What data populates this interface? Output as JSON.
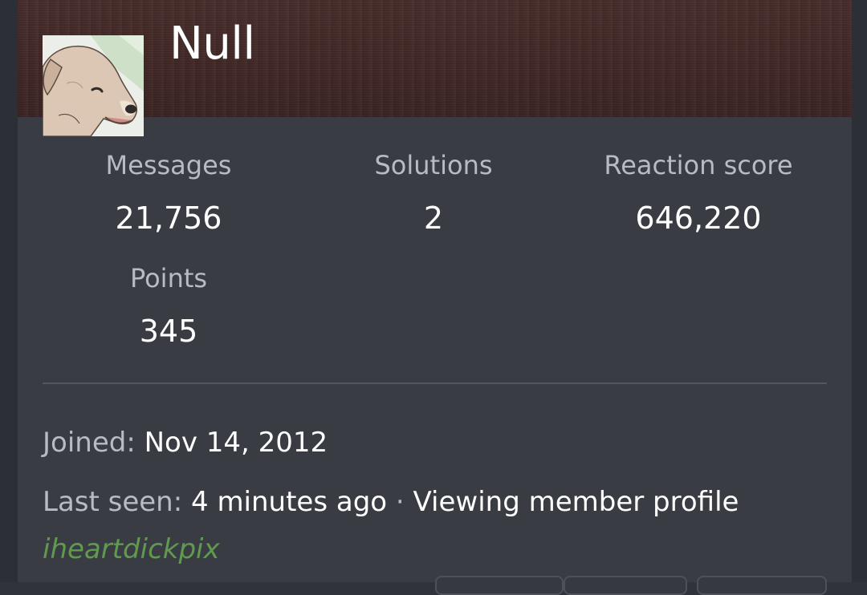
{
  "profile": {
    "username": "Null",
    "avatar_icon": "dog-avatar",
    "custom_title": "iheartdickpix"
  },
  "stats": {
    "messages": {
      "label": "Messages",
      "value": "21,756"
    },
    "solutions": {
      "label": "Solutions",
      "value": "2"
    },
    "reaction_score": {
      "label": "Reaction score",
      "value": "646,220"
    },
    "points": {
      "label": "Points",
      "value": "345"
    }
  },
  "info": {
    "joined_label": "Joined:",
    "joined_value": "Nov 14, 2012",
    "last_seen_label": "Last seen:",
    "last_seen_value": "4 minutes ago",
    "separator": "·",
    "activity": "Viewing member profile"
  },
  "colors": {
    "banner": "#432927",
    "card": "#393c43",
    "label": "#b8bbc1",
    "custom_title": "#5f9a4f"
  }
}
